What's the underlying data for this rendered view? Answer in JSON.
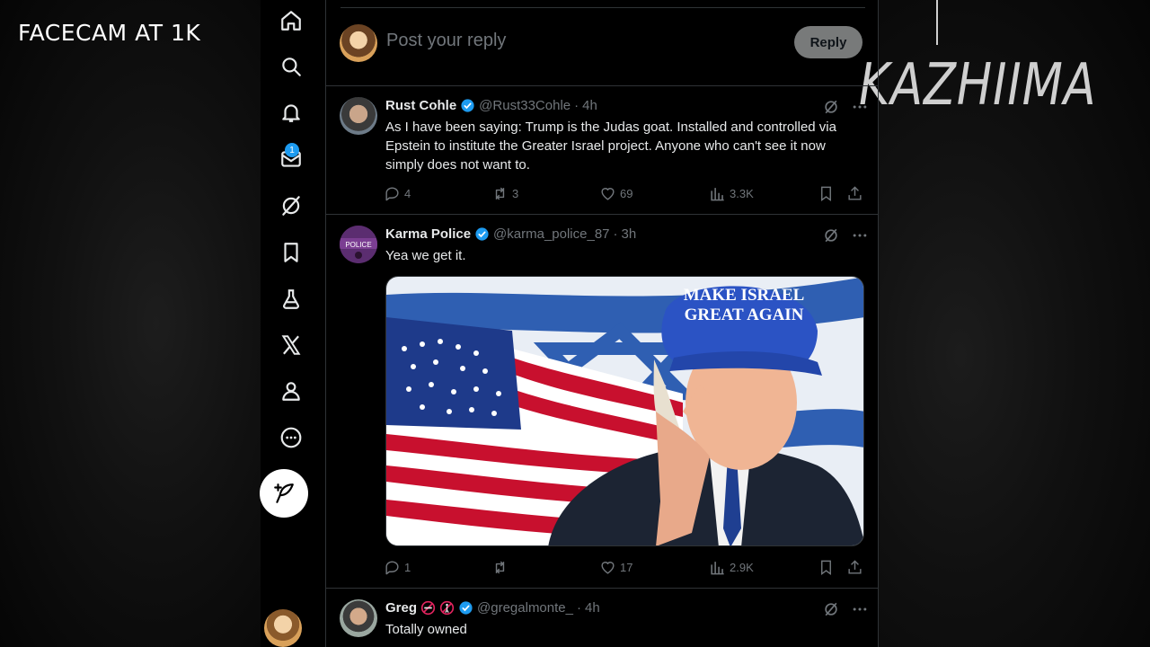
{
  "overlay": {
    "facecam_label": "FACECAM AT 1K",
    "brand": "KAZHIIMA"
  },
  "nav": {
    "items": [
      {
        "name": "home-icon"
      },
      {
        "name": "search-icon"
      },
      {
        "name": "notifications-icon"
      },
      {
        "name": "messages-icon"
      },
      {
        "name": "grok-icon"
      },
      {
        "name": "bookmarks-icon"
      },
      {
        "name": "labs-icon"
      },
      {
        "name": "x-logo-icon"
      },
      {
        "name": "profile-icon"
      },
      {
        "name": "more-icon"
      }
    ],
    "messages_badge": "1",
    "compose_icon": "feather-plus-icon"
  },
  "reply_box": {
    "placeholder": "Post your reply",
    "button_label": "Reply"
  },
  "tweets": [
    {
      "name": "Rust Cohle",
      "handle": "@Rust33Cohle",
      "time": "4h",
      "text": "As I have been saying: Trump is the Judas goat. Installed and controlled via Epstein to institute the Greater Israel project. Anyone who can't see it now simply does not want to.",
      "replies": "4",
      "reposts": "3",
      "likes": "69",
      "views": "3.3K"
    },
    {
      "name": "Karma Police",
      "handle": "@karma_police_87",
      "time": "3h",
      "text": "Yea we get it.",
      "avatar_text": "POLICE",
      "media_hat_line1": "MAKE ISRAEL",
      "media_hat_line2": "GREAT AGAIN",
      "replies": "1",
      "reposts": "",
      "likes": "17",
      "views": "2.9K"
    },
    {
      "name": "Greg",
      "handle": "@gregalmonte_",
      "time": "4h",
      "text": "Totally owned"
    }
  ],
  "colors": {
    "accent": "#1d9bf0",
    "divider": "#2f3336",
    "muted": "#71767b",
    "text": "#e7e9ea"
  }
}
